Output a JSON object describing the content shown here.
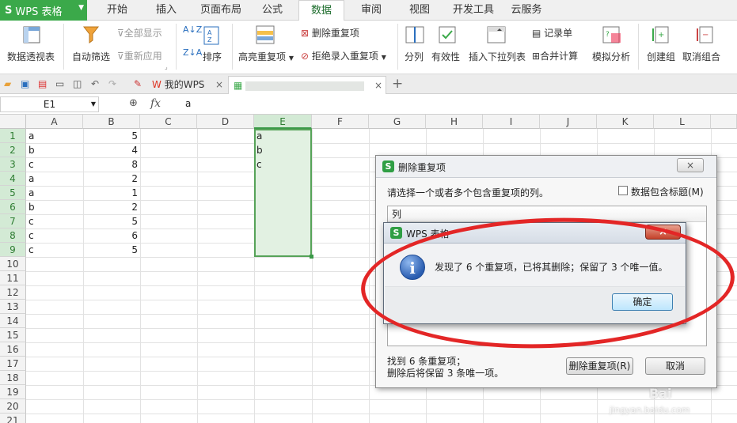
{
  "app": {
    "name": "WPS 表格"
  },
  "menu": {
    "items": [
      "开始",
      "插入",
      "页面布局",
      "公式",
      "数据",
      "审阅",
      "视图",
      "开发工具",
      "云服务"
    ],
    "active": "数据"
  },
  "ribbon": {
    "pivot": "数据透视表",
    "autofilter": "自动筛选",
    "show_all": "全部显示",
    "reapply": "重新应用",
    "sort": "排序",
    "highlight_dup": "高亮重复项",
    "remove_dup": "删除重复项",
    "reject_dup": "拒绝录入重复项",
    "split": "分列",
    "validity": "有效性",
    "dropdown": "插入下拉列表",
    "record": "记录单",
    "consolidate": "合并计算",
    "whatif": "模拟分析",
    "group": "创建组",
    "ungroup": "取消组合"
  },
  "tabs": {
    "mywps": "我的WPS"
  },
  "formula": {
    "cell_ref": "E1",
    "fx": "fx",
    "value": "a"
  },
  "columns": [
    "A",
    "B",
    "C",
    "D",
    "E",
    "F",
    "G",
    "H",
    "I",
    "J",
    "K",
    "L"
  ],
  "rows": [
    "1",
    "2",
    "3",
    "4",
    "5",
    "6",
    "7",
    "8",
    "9",
    "10",
    "11",
    "12",
    "13",
    "14",
    "15",
    "16",
    "17",
    "18",
    "19",
    "20",
    "21"
  ],
  "colA": [
    "a",
    "b",
    "c",
    "a",
    "a",
    "b",
    "c",
    "c",
    "c"
  ],
  "colB": [
    "5",
    "4",
    "8",
    "2",
    "1",
    "2",
    "5",
    "6",
    "5"
  ],
  "colE": [
    "a",
    "b",
    "c"
  ],
  "dialog": {
    "title": "删除重复项",
    "prompt": "请选择一个或者多个包含重复项的列。",
    "header_checkbox": "数据包含标题(M)",
    "list_header": "列",
    "found_text": "找到 6 条重复项；",
    "keep_text": "删除后将保留 3 条唯一项。",
    "remove_button": "删除重复项(R)",
    "cancel_button": "取消"
  },
  "message": {
    "title": "WPS 表格",
    "text": "发现了 6 个重复项，已将其删除；保留了 3 个唯一值。",
    "ok": "确定"
  },
  "watermark": {
    "line1": "Bai",
    "line2": "jingyan.baidu.com"
  },
  "colors": {
    "accent": "#3ba94a",
    "selection": "#e2f1e2",
    "annotation": "#e32626"
  }
}
